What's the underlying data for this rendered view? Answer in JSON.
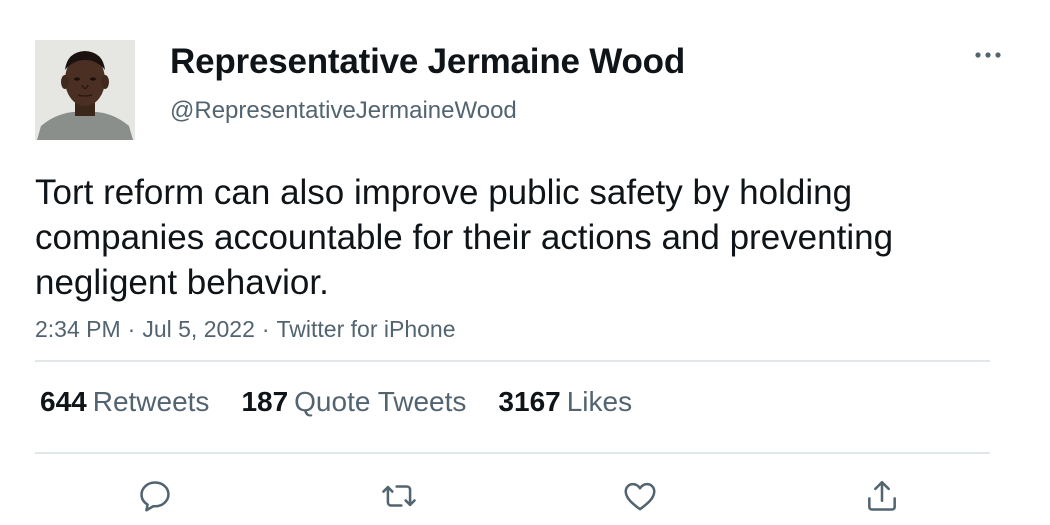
{
  "author": {
    "display_name": "Representative Jermaine Wood",
    "handle": "@RepresentativeJermaineWood"
  },
  "tweet": {
    "text": "Tort reform can also improve public safety by holding companies accountable for their actions and preventing negligent behavior.",
    "time": "2:34 PM",
    "date": "Jul 5, 2022",
    "source": "Twitter for iPhone",
    "separator": "·"
  },
  "stats": {
    "retweets": {
      "count": "644",
      "label": "Retweets"
    },
    "quote_tweets": {
      "count": "187",
      "label": "Quote Tweets"
    },
    "likes": {
      "count": "3167",
      "label": "Likes"
    }
  },
  "icons": {
    "more": "more-horizontal-icon",
    "reply": "reply-icon",
    "retweet": "retweet-icon",
    "like": "heart-icon",
    "share": "share-icon"
  },
  "colors": {
    "text": "#0f1419",
    "secondary": "#536471",
    "divider": "#e1e6e9"
  }
}
